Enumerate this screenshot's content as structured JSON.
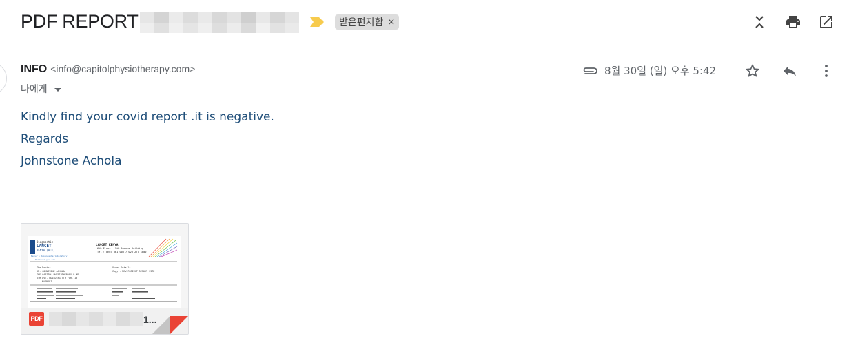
{
  "header": {
    "subject": "PDF REPORT",
    "label": "받은편지함",
    "label_remove": "×",
    "icons": [
      "collapse-all-icon",
      "print-icon",
      "open-new-window-icon"
    ]
  },
  "sender": {
    "name": "INFO",
    "email": "<info@capitolphysiotherapy.com>",
    "to": "나에게"
  },
  "meta": {
    "date": "8월 30일 (일) 오후 5:42"
  },
  "body": {
    "lines": [
      "Kindly find your covid report .it is negative.",
      "Regards",
      "Johnstone Achola"
    ]
  },
  "attachment": {
    "type_badge": "PDF",
    "filename_tail": "1...",
    "preview": {
      "company": "LANCET KENYA",
      "address1": "6th Floor - 5th Avenue Building",
      "address2": "Tel : 0703 061 000 / 020 277 1000",
      "doctor_label": "The Doctor",
      "doctor": "DR. JOHNSTONE ACHOLA",
      "clinic1": "THE CAPITOL PHYSIOTHERAPY & MD",
      "clinic2": "5TH AVE. BUILDING,5TH FLR. 13",
      "clinic3": "NAIROBI",
      "copy_label": "Order Details",
      "copy": "Copy : NEW PATIENT REPORT SIZE"
    }
  },
  "colors": {
    "body_text": "#1f4e79",
    "label_bg": "#dddddd",
    "important_marker": "#f7cb4d",
    "pdf_red": "#ea4335"
  }
}
